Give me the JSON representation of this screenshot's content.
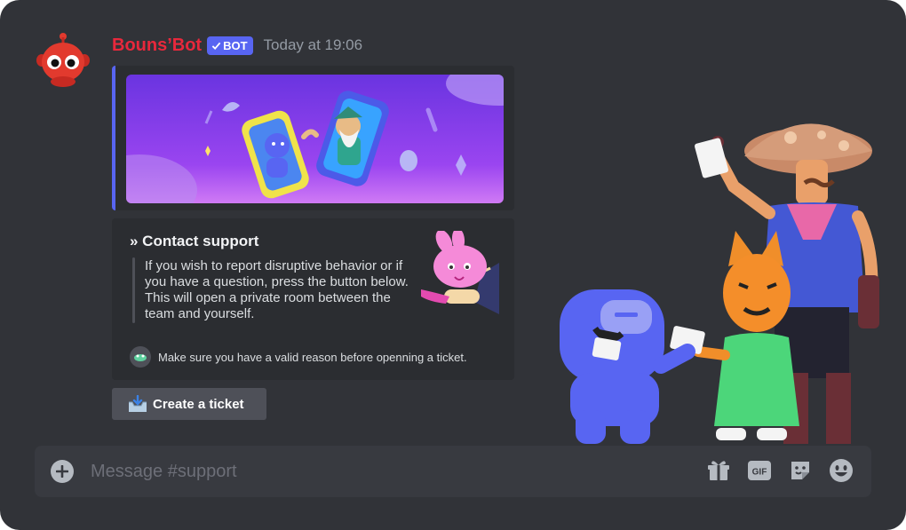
{
  "message": {
    "username": "Bouns’Bot",
    "badge": "BOT",
    "timestamp": "Today at 19:06"
  },
  "embed": {
    "title": "» Contact support",
    "description": "If you wish to report disruptive behavior or if you have a question, press the button below. This will open a private room between the team and yourself.",
    "footer": "Make sure you have a valid reason before openning a ticket."
  },
  "button": {
    "label": "Create a ticket"
  },
  "composer": {
    "placeholder": "Message #support"
  },
  "icons": {
    "avatar": "robot-avatar",
    "verified": "check-icon",
    "ticket": "inbox-icon",
    "add": "plus-circle-icon",
    "gift": "gift-icon",
    "gif": "gif-icon",
    "sticker": "sticker-icon",
    "emoji": "emoji-icon"
  },
  "colors": {
    "username": "#e8283c",
    "accent": "#5865f2",
    "background": "#313338"
  }
}
